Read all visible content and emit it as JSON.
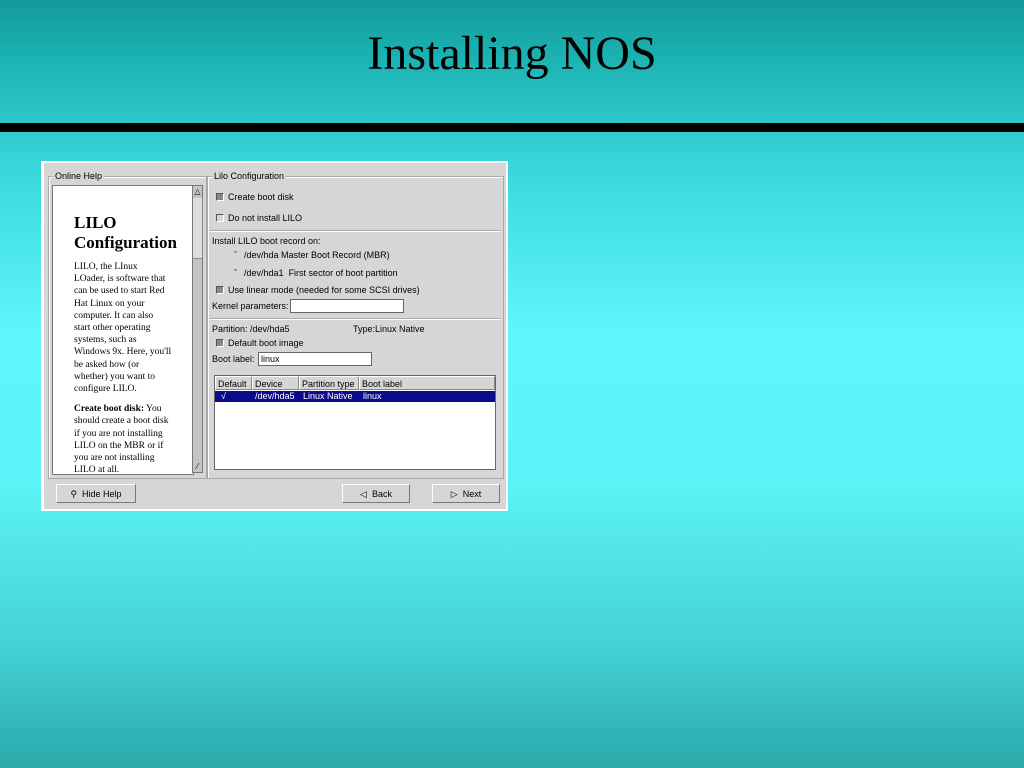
{
  "slide": {
    "title": "Installing NOS"
  },
  "window": {
    "help_group_label": "Online Help",
    "config_group_label": "Lilo Configuration"
  },
  "help": {
    "heading_line1": "LILO",
    "heading_line2": "Configuration",
    "paragraph1_lines": [
      "LILO, the LInux",
      "LOader, is software that",
      "can be used to start Red",
      "Hat Linux on your",
      "computer. It can also",
      "start other operating",
      "systems, such as",
      "Windows 9x. Here, you'll",
      "be asked how (or",
      "whether) you want to",
      "configure LILO."
    ],
    "paragraph2_label": "Create boot disk:",
    "paragraph2_first": " You",
    "paragraph2_lines": [
      "should create a boot disk",
      "if you are not installing",
      "LILO on the MBR or if",
      "you are not installing",
      "LILO at all."
    ]
  },
  "config": {
    "create_boot_disk": "Create boot disk",
    "do_not_install": "Do not install LILO",
    "install_record_label": "Install LILO boot record on:",
    "mbr_device": "/dev/hda",
    "mbr_desc": "Master Boot Record (MBR)",
    "partition_device": "/dev/hda1",
    "partition_desc": "First sector of boot partition",
    "linear_mode": "Use linear mode (needed for some SCSI drives)",
    "kernel_params_label": "Kernel parameters:",
    "kernel_params_value": "",
    "partition_label": "Partition: /dev/hda5",
    "type_label": "Type:Linux Native",
    "default_boot_image": "Default boot image",
    "boot_label_label": "Boot label:",
    "boot_label_value": "linux"
  },
  "table": {
    "headers": [
      "Default",
      "Device",
      "Partition type",
      "Boot label"
    ],
    "rows": [
      {
        "default": "√",
        "device": "/dev/hda5",
        "type": "Linux Native",
        "label": "linux"
      }
    ]
  },
  "buttons": {
    "hide_help": "Hide Help",
    "back": "Back",
    "next": "Next"
  },
  "icons": {
    "hide_help": "help-icon",
    "back": "left-triangle-icon",
    "next": "right-triangle-icon"
  }
}
